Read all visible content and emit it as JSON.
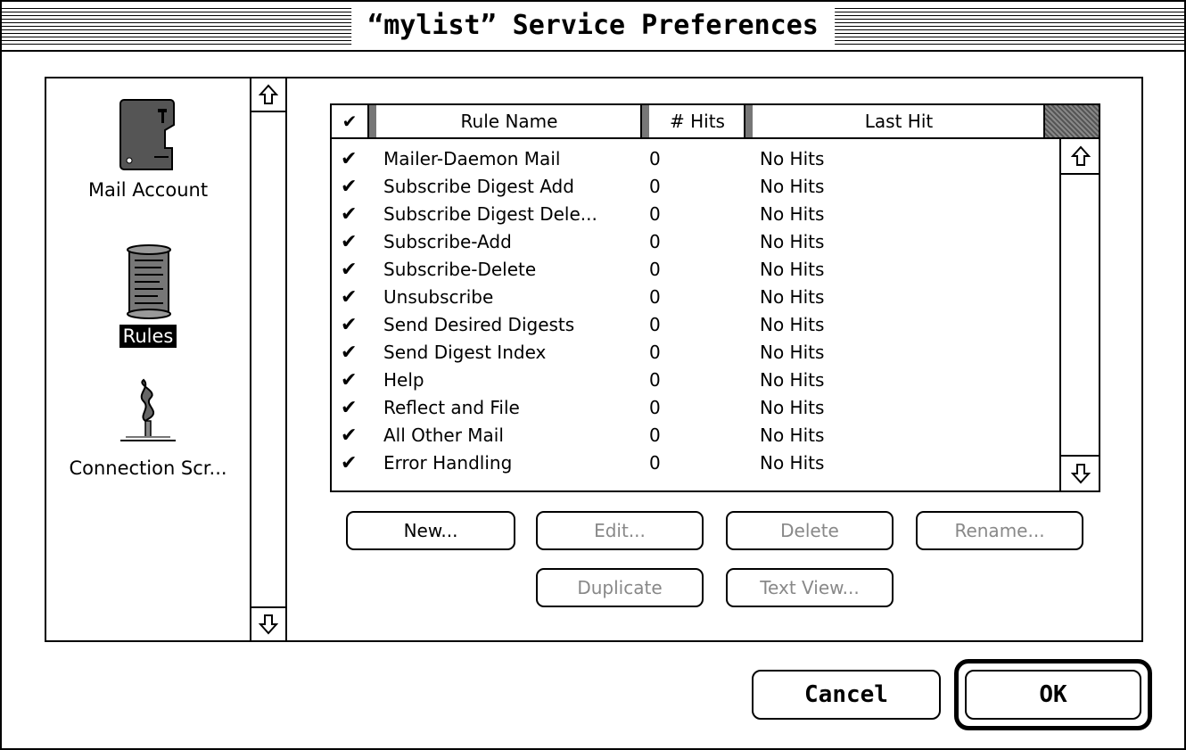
{
  "window": {
    "title": "“mylist” Service Preferences"
  },
  "sidebar": {
    "items": [
      {
        "label": "Mail Account",
        "icon": "mail-account-icon",
        "selected": false
      },
      {
        "label": "Rules",
        "icon": "rules-scroll-icon",
        "selected": true
      },
      {
        "label": "Connection Scr...",
        "icon": "connection-script-icon",
        "selected": false
      }
    ]
  },
  "table": {
    "columns": {
      "check": "✔",
      "name": "Rule Name",
      "hits": "# Hits",
      "last": "Last Hit"
    },
    "rows": [
      {
        "check": "✔",
        "name": "Mailer-Daemon Mail",
        "hits": "0",
        "last": "No Hits"
      },
      {
        "check": "✔",
        "name": "Subscribe Digest Add",
        "hits": "0",
        "last": "No Hits"
      },
      {
        "check": "✔",
        "name": "Subscribe Digest Dele...",
        "hits": "0",
        "last": "No Hits"
      },
      {
        "check": "✔",
        "name": "Subscribe-Add",
        "hits": "0",
        "last": "No Hits"
      },
      {
        "check": "✔",
        "name": "Subscribe-Delete",
        "hits": "0",
        "last": "No Hits"
      },
      {
        "check": "✔",
        "name": "Unsubscribe",
        "hits": "0",
        "last": "No Hits"
      },
      {
        "check": "✔",
        "name": "Send Desired Digests",
        "hits": "0",
        "last": "No Hits"
      },
      {
        "check": "✔",
        "name": "Send Digest Index",
        "hits": "0",
        "last": "No Hits"
      },
      {
        "check": "✔",
        "name": "Help",
        "hits": "0",
        "last": "No Hits"
      },
      {
        "check": "✔",
        "name": "Reflect and File",
        "hits": "0",
        "last": "No Hits"
      },
      {
        "check": "✔",
        "name": "All Other Mail",
        "hits": "0",
        "last": "No Hits"
      },
      {
        "check": "✔",
        "name": "Error Handling",
        "hits": "0",
        "last": "No Hits"
      }
    ]
  },
  "buttons": {
    "new": "New...",
    "edit": "Edit...",
    "delete": "Delete",
    "rename": "Rename...",
    "duplicate": "Duplicate",
    "text_view": "Text View...",
    "cancel": "Cancel",
    "ok": "OK"
  }
}
